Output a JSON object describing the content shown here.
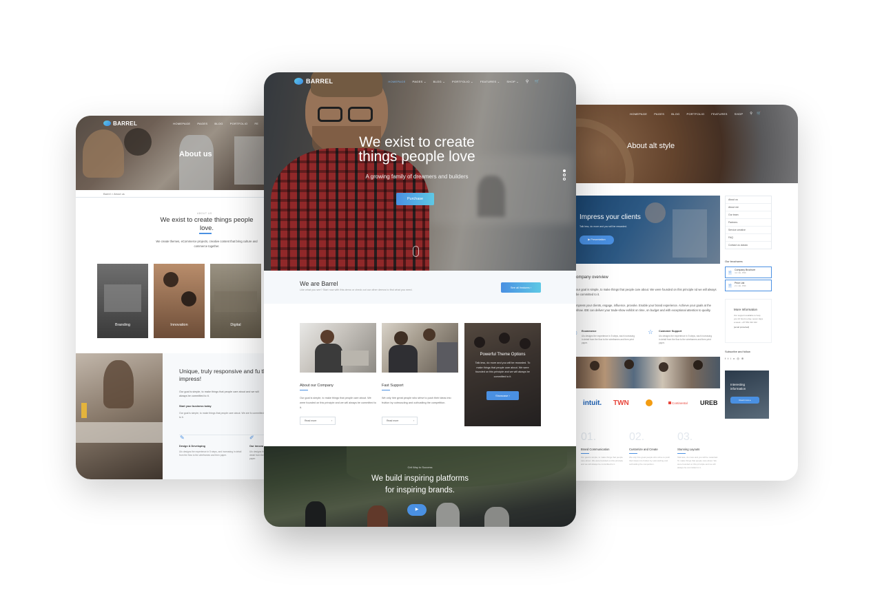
{
  "left": {
    "brand": "BARREL",
    "nav": [
      "HOMEPAGE",
      "PAGES",
      "BLOG",
      "PORTFOLIO",
      "FE"
    ],
    "hero_title": "About us",
    "breadcrumb": [
      "Barrel",
      "About us"
    ],
    "kicker": "ABOUT US",
    "heading": "We exist to create things people love.",
    "lead": "We create themes, eCommerce projects, creative content that bring culture and commerce together.",
    "tiles": [
      "Branding",
      "Innovation",
      "Digital"
    ],
    "feature_title": "Unique, truly responsive and fu that impress!",
    "feature_text": "Our goal is simple, to make things that people care about and we will always be committed to it.",
    "sub_label": "Start your business today",
    "sub_text": "Our goal is simple, to make things that people care about. We are fo committed to it.",
    "services": [
      {
        "title": "Design & Developing",
        "text": "Ulo designs the experience in 5 steps, and increasing in detail from the flow to the wireframes and then paper."
      },
      {
        "title": "Our innova",
        "text": "Ulo designs the experience in detail from the flow to the paper."
      }
    ]
  },
  "center": {
    "brand": "BARREL",
    "nav": [
      "HOMEPAGE",
      "PAGES",
      "BLOG",
      "PORTFOLIO",
      "FEATURES",
      "SHOP"
    ],
    "hero_title_1": "We exist to create",
    "hero_title_2": "things people love",
    "hero_sub": "A growing family of dreamers and builders",
    "hero_button": "Purchase",
    "intro_title": "We are Barrel",
    "intro_text": "Like what you see? Start now with this demo or check out our other demos to find what you need.",
    "intro_button": "See all features",
    "cards": [
      {
        "title": "About our Company",
        "text": "Our goal is simple, to make things that people care about. We were founded on this principle and we will always be committed to it.",
        "button": "Read more"
      },
      {
        "title": "Fast Support",
        "text": "We only hire great people who strive to push their ideas into fruition by outmuscling and outhustling the competition.",
        "button": "Read more"
      }
    ],
    "promo_title": "Powerful Theme Options",
    "promo_text": "Talk less, do more and you will be rewarded. To make things that people care about. We were founded on this principle and we will always be committed to it.",
    "promo_button": "Showcase",
    "bottom_kicker": "Grit Way to Success",
    "bottom_title_1": "We build inspiring platforms",
    "bottom_title_2": "for inspiring brands."
  },
  "right": {
    "nav": [
      "HOMEPAGE",
      "PAGES",
      "BLOG",
      "PORTFOLIO",
      "FEATURES",
      "SHOP"
    ],
    "hero_title": "About alt style",
    "banner_title": "Impress your clients",
    "banner_text": "Talk less, do more and you will be rewarded.",
    "banner_button": "Presentation",
    "sidebar_links": [
      "About us",
      "About me",
      "Our team",
      "Partners",
      "Service creative",
      "FAQ",
      "Contact us classic"
    ],
    "brochures_label": "Our brochures",
    "brochures": [
      {
        "title": "Company Brochure",
        "meta": "4.2 mb, PDF"
      },
      {
        "title": "Price List",
        "meta": "2.1 mb, PDF"
      }
    ],
    "more_info_title": "More Information",
    "more_info_text": "Our support available to help you 24 hours a day, seven days a week. +07 554 332 322",
    "more_info_email": "[email protected]",
    "subscribe_label": "Subscribe and follow",
    "interesting_title": "Interesting information",
    "interesting_button": "Read more",
    "overview_title": "ompany overview",
    "overview_text_1": "our goal is simple, to make things that people care about. We were founded on this principle nd we will always be committed to it.",
    "overview_text_2": "mpress your clients, engage, influence, provoke. Enable your brand experience. Achieve your goals at the show. IDE can deliver your trade-show exhibit on time, on budget and with exceptional attention to quality.",
    "features": [
      {
        "title": "Ecommerce",
        "text": "Ulo designs the experience in 5 steps, each increasing in detail from the flow to the wireframes and then print paper."
      },
      {
        "title": "Customer Support",
        "text": "Ulo designs the experience in 5 steps, each increasing in detail from the flow to the wireframes and then print paper."
      }
    ],
    "logos": [
      "intuit.",
      "TWN",
      "",
      "Continental",
      "UREB"
    ],
    "steps": [
      {
        "num": "01.",
        "title": "Brand Communication",
        "text": "Our goal is simple, to make things that people care about. We were founded on this principle and we will always be committed to it."
      },
      {
        "num": "02.",
        "title": "Customize and Create",
        "text": "We only hire great people who strive to push their ideas into fruition by outmuscling and outhustling the competition."
      },
      {
        "num": "03.",
        "title": "Stunning Layouts",
        "text": "Talk less, do more and you will be rewarded. To make things that people care about. We were founded on this principle and we will always be committed to it."
      }
    ]
  },
  "colors": {
    "accent": "#4a90e2",
    "accent_light": "#5ec8e5",
    "brand_red": "#e8463c",
    "brand_orange": "#f39c12"
  }
}
